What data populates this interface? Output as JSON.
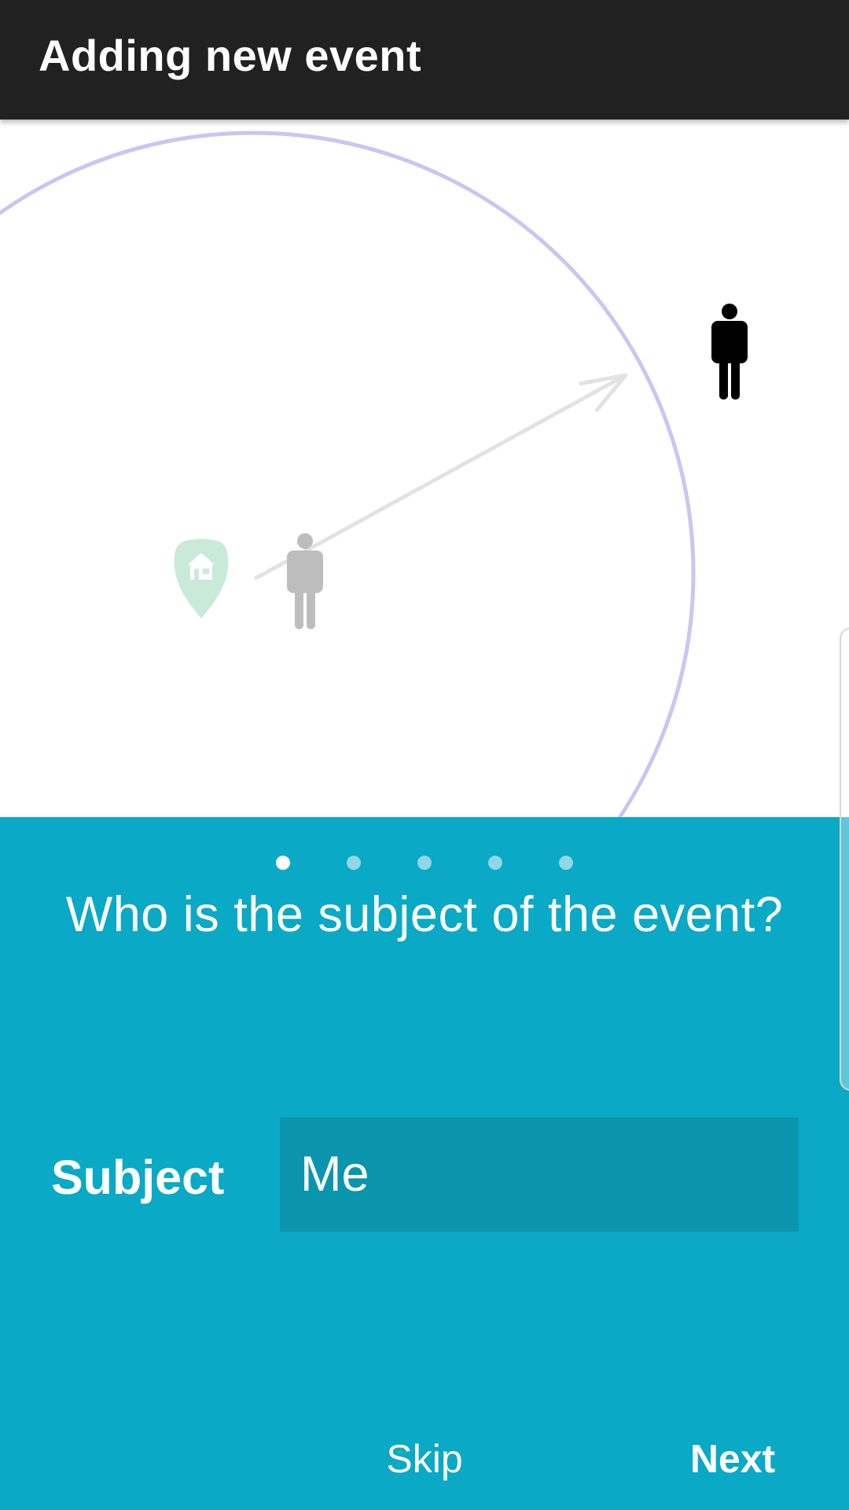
{
  "app_bar": {
    "title": "Adding new event",
    "background": "#212121"
  },
  "illustration": {
    "icons": [
      "home-location-pin-icon",
      "person-start-icon",
      "person-target-icon",
      "arrow-icon"
    ],
    "circle_color": "#c8c6f2",
    "pin_color": "#c9ead8",
    "faded_person_color": "#bdbdbd",
    "active_person_color": "#000000"
  },
  "pager": {
    "total": 5,
    "active_index": 0
  },
  "panel": {
    "background": "#0aa9c6",
    "question": "Who is the subject of the event?",
    "subject_label": "Subject",
    "subject_value": "Me"
  },
  "footer": {
    "skip_label": "Skip",
    "next_label": "Next"
  }
}
